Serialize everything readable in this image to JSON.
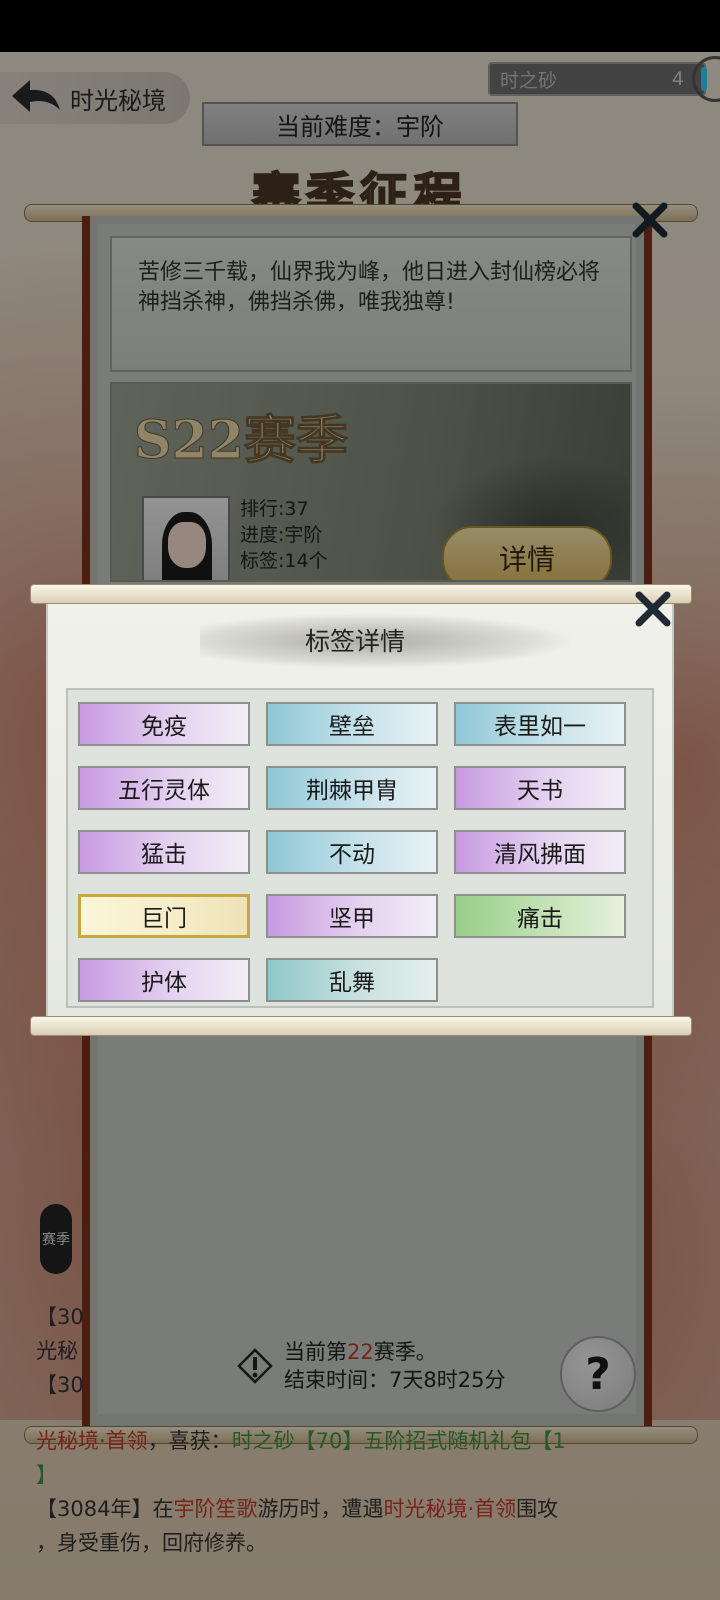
{
  "header": {
    "back_title": "时光秘境",
    "currency_label": "时之砂",
    "currency_count": "4",
    "difficulty": "当前难度：宇阶",
    "season_title": "赛季征程"
  },
  "panel": {
    "motto": "苦修三千载，仙界我为峰，他日进入封仙榜必将神挡杀神，佛挡杀佛，唯我独尊!",
    "season_label": "S22赛季",
    "stats": [
      "排行:37",
      "进度:宇阶",
      "标签:14个"
    ],
    "detail_button": "详情",
    "footer_line1_prefix": "当前第",
    "footer_season_num": "22",
    "footer_line1_suffix": "赛季。",
    "footer_line2": "结束时间：7天8时25分",
    "help_button": "?",
    "side_tab": "赛季"
  },
  "log": {
    "line_a": "【30",
    "line_b": "光秘",
    "line_c": "【30",
    "line_d_red": "光秘境·首领",
    "line_d_mid": "，喜获：",
    "line_d_green": "时之砂【70】五阶招式随机礼包【1",
    "line_e": "】",
    "line_f_a": "【3084年】在",
    "line_f_red1": "宇阶笙歌",
    "line_f_b": "游历时，遭遇",
    "line_f_red2": "时光秘境·首领",
    "line_f_c": "围攻",
    "line_g": "，身受重伤，回府修养。"
  },
  "modal": {
    "title": "标签详情",
    "tags": [
      {
        "label": "免疫",
        "style": "purple"
      },
      {
        "label": "壁垒",
        "style": "blue"
      },
      {
        "label": "表里如一",
        "style": "blue"
      },
      {
        "label": "五行灵体",
        "style": "purple"
      },
      {
        "label": "荆棘甲胄",
        "style": "blue"
      },
      {
        "label": "天书",
        "style": "purple"
      },
      {
        "label": "猛击",
        "style": "purple"
      },
      {
        "label": "不动",
        "style": "blue"
      },
      {
        "label": "清风拂面",
        "style": "purple"
      },
      {
        "label": "巨门",
        "style": "gold"
      },
      {
        "label": "坚甲",
        "style": "purple"
      },
      {
        "label": "痛击",
        "style": "green"
      },
      {
        "label": "护体",
        "style": "purple"
      },
      {
        "label": "乱舞",
        "style": "teal"
      }
    ]
  },
  "colors": {
    "tag_purple": "#c79ae0",
    "tag_blue": "#8fc8d6",
    "tag_gold_border": "#c8a641",
    "tag_green": "#96cf88",
    "highlight_red": "#c0392b",
    "highlight_green": "#3f8f3f"
  }
}
